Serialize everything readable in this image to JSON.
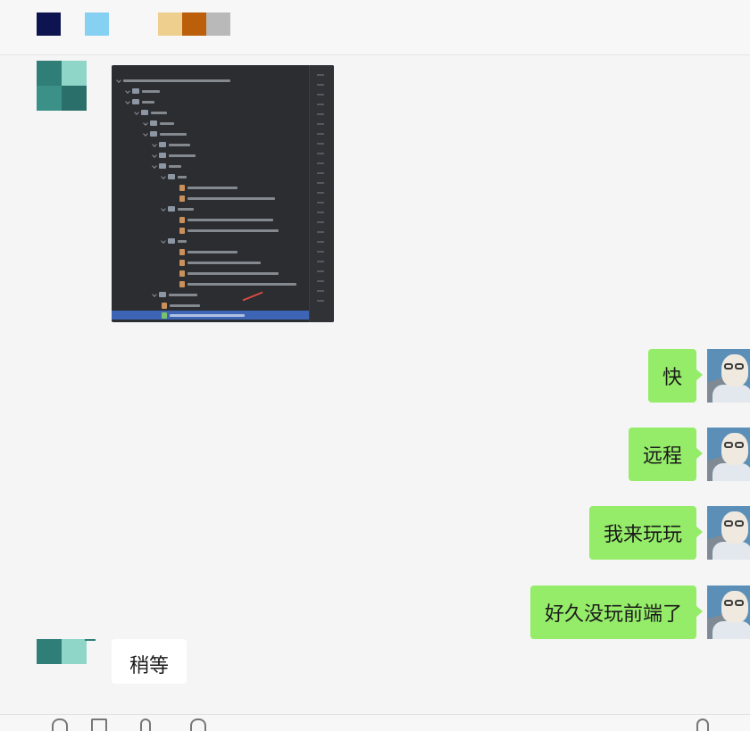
{
  "header": {
    "color_blocks": [
      "#0e1450",
      "#86d1f1",
      "#efcf8e",
      "#bb5f0a",
      "#b9b9b9"
    ]
  },
  "messages": [
    {
      "sender": "other",
      "type": "image",
      "image": "ide-project-tree-screenshot"
    },
    {
      "sender": "me",
      "type": "text",
      "text": "快"
    },
    {
      "sender": "me",
      "type": "text",
      "text": "远程"
    },
    {
      "sender": "me",
      "type": "text",
      "text": "我来玩玩"
    },
    {
      "sender": "me",
      "type": "text",
      "text": "好久没玩前端了"
    },
    {
      "sender": "other",
      "type": "text",
      "text": "稍等"
    }
  ],
  "toolbar": {
    "icons": [
      "emoji-icon",
      "folder-icon",
      "scissors-icon",
      "chat-history-icon",
      "video-call-icon"
    ]
  },
  "colors": {
    "self_bubble": "#95ec69",
    "other_bubble": "#ffffff",
    "chat_background": "#f5f5f5",
    "other_avatar_dark": "#2f7f78",
    "other_avatar_light": "#8fd6c8"
  }
}
